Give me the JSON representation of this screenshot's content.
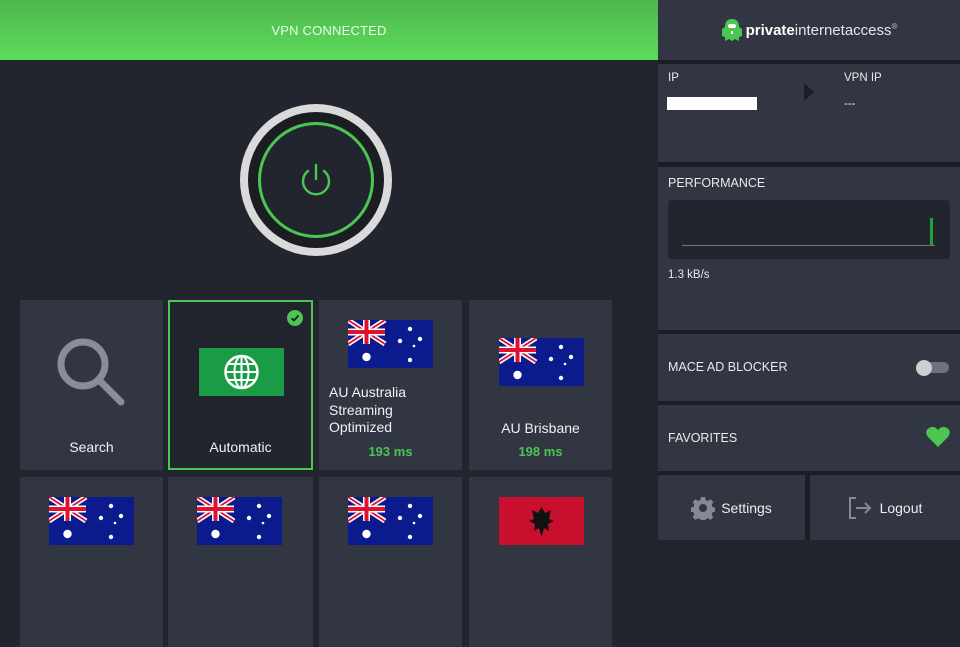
{
  "status_bar": {
    "text": "VPN CONNECTED",
    "color": "#5ddc5b"
  },
  "brand": {
    "bold": "private",
    "light": "internetaccess",
    "mark": "®"
  },
  "ip_panel": {
    "ip_label": "IP",
    "ip_value": "",
    "vpn_ip_label": "VPN IP",
    "vpn_ip_value": "---"
  },
  "performance": {
    "title": "PERFORMANCE",
    "rate": "1.3 kB/s",
    "bar_level": 0.45
  },
  "mace": {
    "label": "MACE AD BLOCKER",
    "enabled": false
  },
  "favorites": {
    "label": "FAVORITES"
  },
  "buttons": {
    "settings": "Settings",
    "logout": "Logout"
  },
  "regions": [
    {
      "label": "Search",
      "type": "search"
    },
    {
      "label": "Automatic",
      "type": "auto",
      "selected": true
    },
    {
      "label": "AU Australia Streaming Optimized",
      "latency": "193 ms",
      "flag": "au"
    },
    {
      "label": "AU Brisbane",
      "latency": "198 ms",
      "flag": "au"
    },
    {
      "label": "",
      "flag": "au"
    },
    {
      "label": "",
      "flag": "au"
    },
    {
      "label": "",
      "flag": "au"
    },
    {
      "label": "",
      "flag": "al"
    }
  ],
  "colors": {
    "accent": "#4cc652",
    "panel": "#323542",
    "background": "#22252e"
  }
}
